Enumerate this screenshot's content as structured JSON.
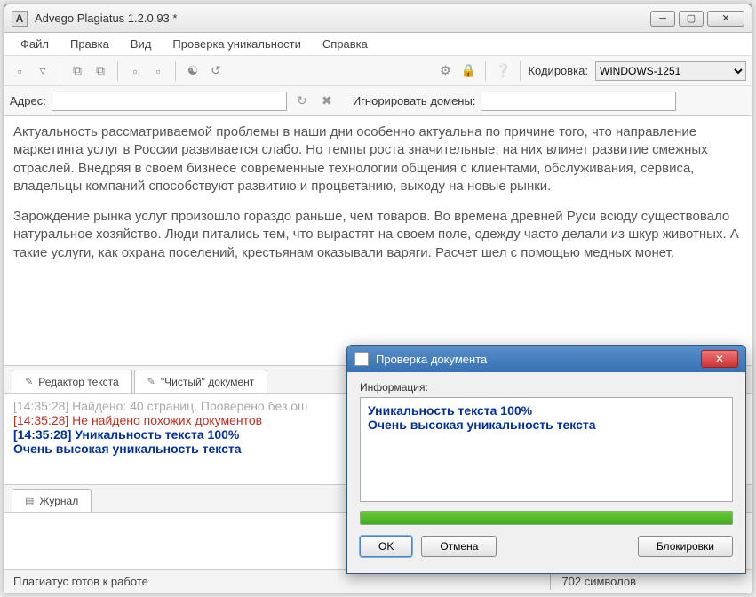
{
  "window": {
    "title": "Advego Plagiatus 1.2.0.93 *"
  },
  "menu": {
    "file": "Файл",
    "edit": "Правка",
    "view": "Вид",
    "check": "Проверка уникальности",
    "help": "Справка"
  },
  "toolbar": {
    "enc_label": "Кодировка:",
    "enc_value": "WINDOWS-1251"
  },
  "addrbar": {
    "addr_label": "Адрес:",
    "addr_value": "",
    "ignore_label": "Игнорировать домены:",
    "ignore_value": ""
  },
  "text": {
    "p1": "Актуальность рассматриваемой проблемы в наши дни особенно актуальна по причине того, что направление маркетинга услуг в России развивается слабо. Но темпы роста значительные, на них влияет развитие смежных отраслей. Внедряя в своем бизнесе современные технологии общения с клиентами, обслуживания, сервиса, владельцы компаний способствуют развитию и процветанию, выходу на новые рынки.",
    "p2": "Зарождение рынка услуг произошло гораздо раньше, чем товаров. Во времена древней Руси всюду существовало натуральное хозяйство. Люди питались тем, что вырастят на своем поле, одежду часто делали из шкур животных. А такие услуги, как охрана поселений, крестьянам оказывали варяги. Расчет шел с помощью медных монет."
  },
  "tabs": {
    "editor": "Редактор текста",
    "clean": "\"Чистый\" документ",
    "journal": "Журнал"
  },
  "log": {
    "l1": "[14:35:28] Найдено: 40 страниц. Проверено без ош",
    "l2": "[14:35:28] Не найдено похожих документов",
    "l3": "[14:35:28] Уникальность текста 100%",
    "l4": "Очень высокая уникальность текста"
  },
  "status": {
    "ready": "Плагиатус готов к работе",
    "chars": "702 символов"
  },
  "dialog": {
    "title": "Проверка документа",
    "info_label": "Информация:",
    "line1": "Уникальность текста 100%",
    "line2": "Очень высокая уникальность текста",
    "ok": "OK",
    "cancel": "Отмена",
    "block": "Блокировки"
  }
}
